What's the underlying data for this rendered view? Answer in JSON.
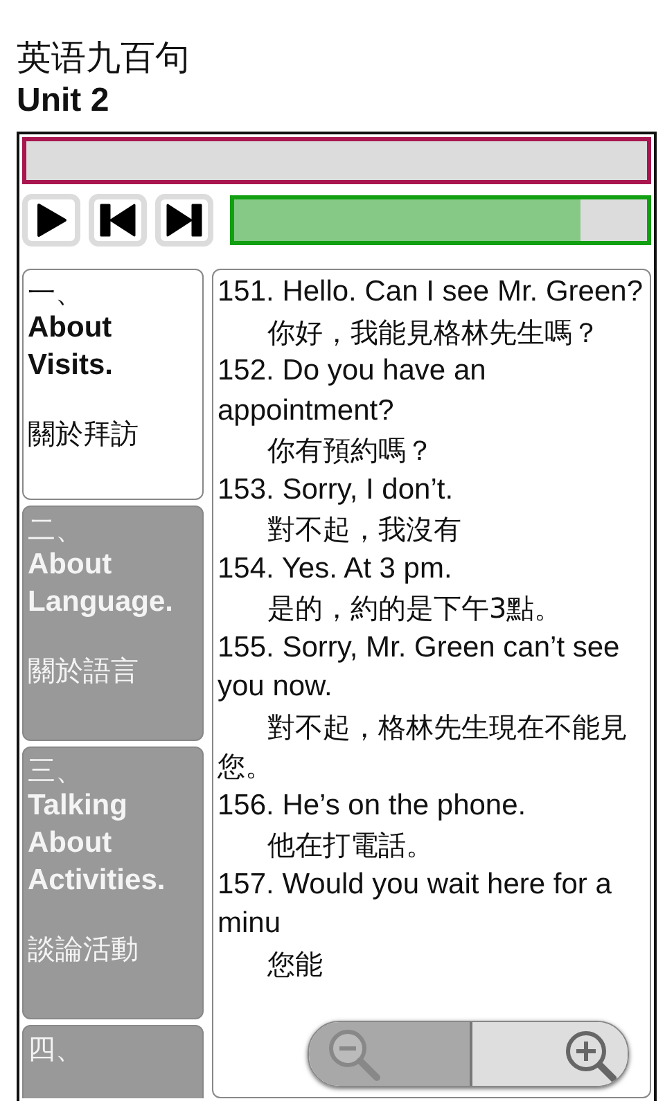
{
  "header": {
    "title": "英语九百句",
    "subtitle": "Unit 2"
  },
  "player": {
    "progress": {
      "level": 0.84
    }
  },
  "sections": [
    {
      "number": "一、",
      "english": "About Visits.",
      "chinese": "關於拜訪",
      "selected": true
    },
    {
      "number": "二、",
      "english": "About Language.",
      "chinese": "關於語言",
      "selected": false
    },
    {
      "number": "三、",
      "english": "Talking About Activities.",
      "chinese": "談論活動",
      "selected": false
    },
    {
      "number": "四、",
      "selected": false
    }
  ],
  "sentences": [
    {
      "english": "151. Hello. Can I see Mr. Green?",
      "chinese": "你好，我能見格林先生嗎？"
    },
    {
      "english": "152. Do you have an appointment?",
      "chinese": "你有預約嗎？"
    },
    {
      "english": "153. Sorry, I don’t.",
      "chinese": "對不起，我沒有"
    },
    {
      "english": "154. Yes. At 3 pm.",
      "chinese": "是的，約的是下午3點。"
    },
    {
      "english": "155. Sorry, Mr. Green can’t see you now.",
      "chinese": "對不起，格林先生現在不能見您。"
    },
    {
      "english": "156. He’s on the phone.",
      "chinese": "他在打電話。"
    },
    {
      "english": "157. Would you wait here for a minu",
      "chinese": "您能"
    }
  ]
}
